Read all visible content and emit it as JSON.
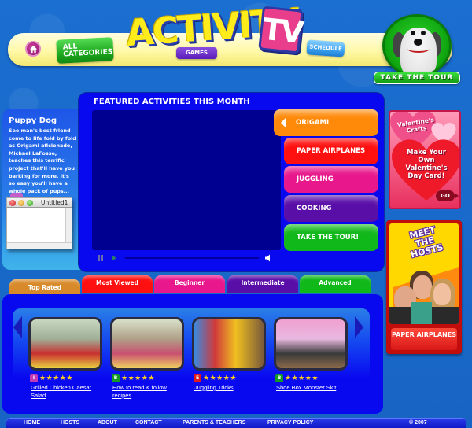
{
  "colors": {
    "background": "#1a6ccc",
    "panel_blue": "#0909f0",
    "video_navy": "#000090",
    "header_yellow": "#fff9a8",
    "logo_yellow": "#ffec1a",
    "logo_pink": "#e83e8c",
    "star_yellow": "#ffd21a"
  },
  "header": {
    "logo_text": "ACTIVITY",
    "logo_tv": "TV",
    "nav": {
      "home_icon": "home-icon",
      "all_categories_label": "ALL CATEGORIES",
      "games_label": "GAMES",
      "schedule_label": "SCHEDULE"
    },
    "tour": {
      "label": "TAKE THE TOUR"
    }
  },
  "description": {
    "title": "Puppy Dog",
    "text": "See man's best friend come to life fold by fold as Origami aficionado, Michael LaFosse, teaches this terrific project that'll have you barking for more. It's so easy you'll have a whole pack of pups..."
  },
  "overlay_window": {
    "title": "Untitled1"
  },
  "featured": {
    "title": "FEATURED ACTIVITIES THIS MONTH",
    "categories": [
      {
        "label": "ORIGAMI",
        "color": "#ff8a0a",
        "active": true
      },
      {
        "label": "PAPER AIRPLANES",
        "color": "#ff1010",
        "active": false
      },
      {
        "label": "JUGGLING",
        "color": "#e8188c",
        "active": false
      },
      {
        "label": "COOKING",
        "color": "#5a0ea8",
        "active": false
      },
      {
        "label": "TAKE THE TOUR!",
        "color": "#10b81a",
        "active": false
      }
    ],
    "player": {
      "pause_icon": "pause-icon",
      "play_icon": "play-icon",
      "volume_icon": "volume-icon",
      "progress": 0
    }
  },
  "promos": {
    "valentine": {
      "heading": "Valentine's Crafts",
      "body": "Make Your Own Valentine's Day Card!",
      "go_label": "GO"
    },
    "hosts": {
      "heading": "MEET THE HOSTS",
      "button_label": "PAPER AIRPLANES"
    }
  },
  "tabs": [
    {
      "label": "Top Rated",
      "color": "#d88a2a",
      "active": true
    },
    {
      "label": "Most Viewed",
      "color": "#ff1010",
      "active": false
    },
    {
      "label": "Beginner",
      "color": "#e8188c",
      "active": false
    },
    {
      "label": "Intermediate",
      "color": "#5a0ea8",
      "active": false
    },
    {
      "label": "Advanced",
      "color": "#10b81a",
      "active": false
    }
  ],
  "carousel": {
    "items": [
      {
        "title": "Grilled Chicken Caesar Salad",
        "level": "I",
        "level_color": "#c03ab8",
        "stars": 5
      },
      {
        "title": "How to read & follow recipes",
        "level": "B",
        "level_color": "#129a22",
        "stars": 5
      },
      {
        "title": "Juggling Tricks",
        "level": "E",
        "level_color": "#e01a1a",
        "stars": 5
      },
      {
        "title": "Shoe Box Monster Skit",
        "level": "B",
        "level_color": "#129a22",
        "stars": 5
      }
    ]
  },
  "footer": {
    "links": [
      "HOME",
      "HOSTS",
      "ABOUT",
      "CONTACT",
      "PARENTS & TEACHERS",
      "PRIVACY POLICY"
    ],
    "copyright": "© 2007"
  }
}
